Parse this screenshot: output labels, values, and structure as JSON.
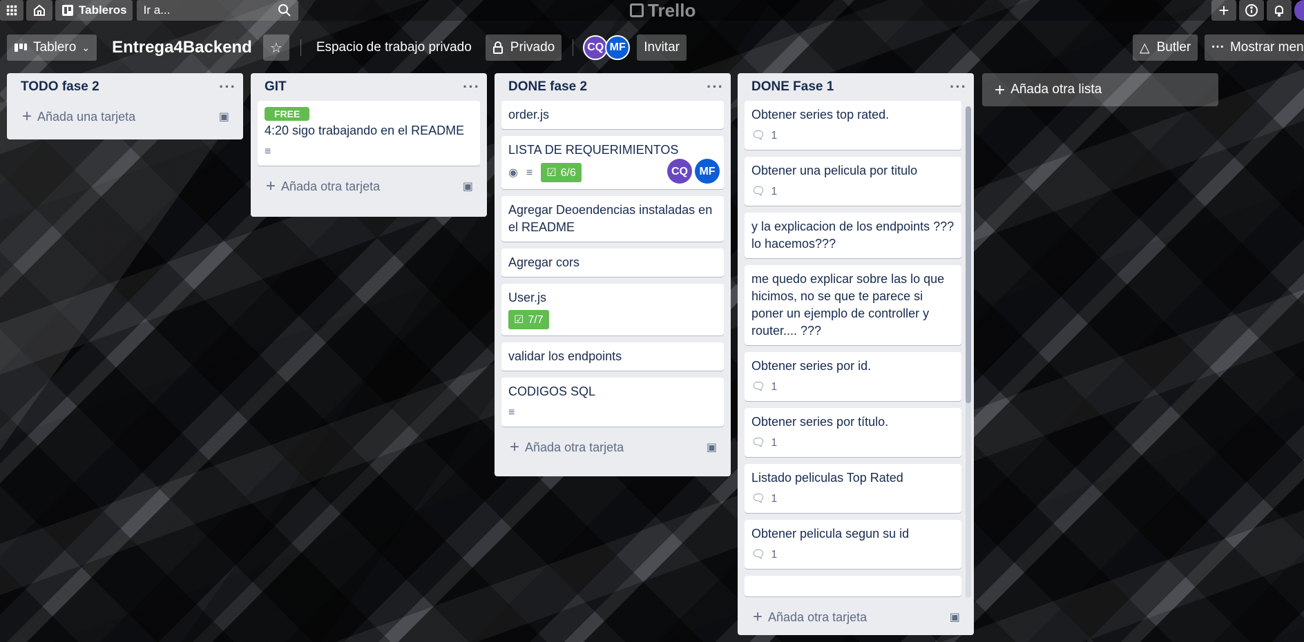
{
  "nav": {
    "boards_label": "Tableros",
    "search_placeholder": "Ir a...",
    "logo_text": "Trello"
  },
  "header": {
    "view_label": "Tablero",
    "board_title": "Entrega4Backend",
    "workspace_label": "Espacio de trabajo privado",
    "privacy_label": "Privado",
    "members": [
      {
        "initials": "CQ",
        "color": "#6b46c1"
      },
      {
        "initials": "MF",
        "color": "#0b5ed7"
      }
    ],
    "invite_label": "Invitar",
    "butler_label": "Butler",
    "menu_label": "Mostrar menú"
  },
  "lists": [
    {
      "title": "TODO fase 2",
      "add_card_label": "Añada una tarjeta"
    },
    {
      "title": "GIT",
      "add_card_label": "Añada otra tarjeta",
      "cards": [
        {
          "label": "FREE",
          "label_color": "#61bd4f",
          "title": "4:20 sigo trabajando en el README"
        }
      ]
    },
    {
      "title": "DONE fase 2",
      "add_card_label": "Añada otra tarjeta",
      "cards": [
        {
          "title": "order.js"
        },
        {
          "title": "LISTA DE REQUERIMIENTOS",
          "checklist": "6/6",
          "members": [
            "CQ",
            "MF"
          ]
        },
        {
          "title": "Agregar Deoendencias instaladas en el README"
        },
        {
          "title": "Agregar cors"
        },
        {
          "title": "User.js",
          "checklist": "7/7"
        },
        {
          "title": "validar los endpoints"
        },
        {
          "title": "CODIGOS SQL"
        }
      ]
    },
    {
      "title": "DONE Fase 1",
      "add_card_label": "Añada otra tarjeta",
      "cards": [
        {
          "title": "Obtener series top rated.",
          "comments": "1"
        },
        {
          "title": "Obtener una pelicula por titulo",
          "comments": "1"
        },
        {
          "title": "y la explicacion de los endpoints ??? lo hacemos???"
        },
        {
          "title": "me quedo explicar sobre las lo que hicimos, no se que te parece si poner un ejemplo de controller y router.... ???"
        },
        {
          "title": "Obtener series por id.",
          "comments": "1"
        },
        {
          "title": "Obtener series por título.",
          "comments": "1"
        },
        {
          "title": "Listado peliculas Top Rated",
          "comments": "1"
        },
        {
          "title": "Obtener pelicula segun su id",
          "comments": "1"
        }
      ]
    }
  ],
  "add_list_label": "Añada otra lista",
  "colors": {
    "list_bg": "#ebecf0",
    "label_green": "#61bd4f",
    "text": "#172b4d"
  }
}
